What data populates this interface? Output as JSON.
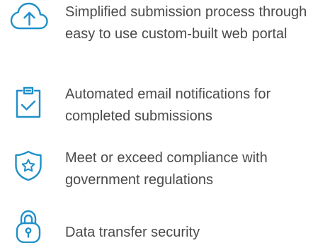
{
  "accent_color": "#1f8fc9",
  "text_color": "#4a4a4a",
  "features": [
    {
      "icon": "cloud-upload-icon",
      "text": "Simplified submission process through easy to use custom-built web portal"
    },
    {
      "icon": "clipboard-check-icon",
      "text": "Automated email notifications for completed submissions"
    },
    {
      "icon": "shield-star-icon",
      "text": "Meet or exceed compliance with government regulations"
    },
    {
      "icon": "padlock-icon",
      "text": "Data transfer security"
    }
  ]
}
